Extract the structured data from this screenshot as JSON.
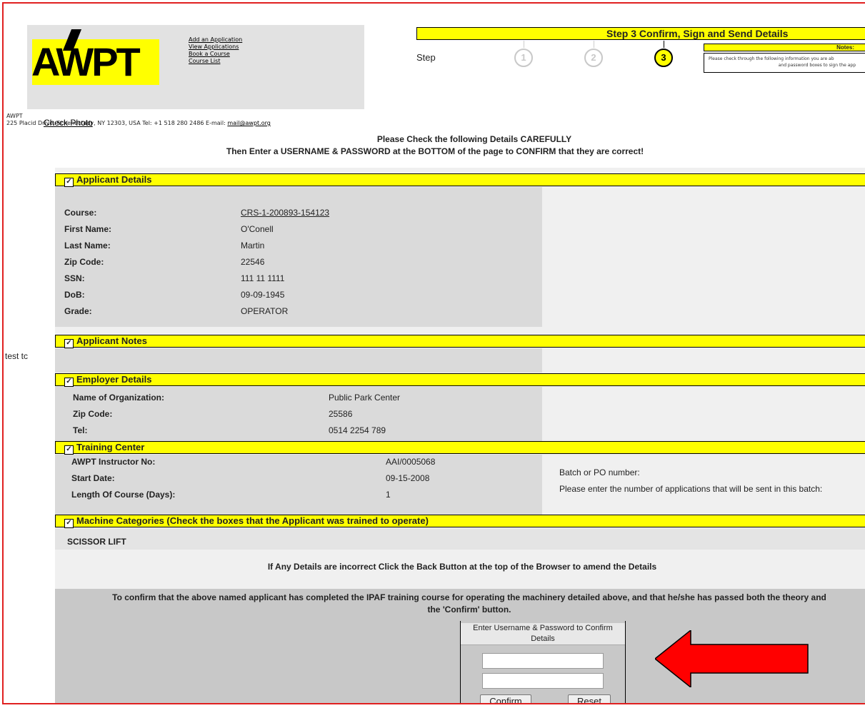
{
  "header": {
    "logo_text": "AWPT",
    "links": [
      "Add an Application",
      "View Applications",
      "Book a Course",
      "Course List"
    ],
    "org_name": "AWPT",
    "address": "225 Placid Drive, Schenectady, NY 12303, USA Tel: +1 518 280 2486 E-mail: ",
    "email": "mail@awpt.org",
    "check_photo": "Check Photo"
  },
  "steps": {
    "title": "Step 3 Confirm, Sign and Send Details",
    "label": "Step",
    "numbers": [
      "1",
      "2",
      "3"
    ],
    "current": 3,
    "notes_title": "Notes:",
    "notes_line1": "Please check through the following information you are ab",
    "notes_line2": "and password boxes to sign the app"
  },
  "warning": {
    "line1": "Please Check the following Details CAREFULLY",
    "line2": "Then Enter a USERNAME & PASSWORD at the BOTTOM of the page to CONFIRM that they are correct!"
  },
  "applicant": {
    "heading": "Applicant Details",
    "fields": [
      {
        "label": "Course:",
        "value": "CRS-1-200893-154123"
      },
      {
        "label": "First Name:",
        "value": "O'Conell"
      },
      {
        "label": "Last Name:",
        "value": "Martin"
      },
      {
        "label": "Zip Code:",
        "value": "22546"
      },
      {
        "label": "SSN:",
        "value": "111 11 1111"
      },
      {
        "label": "DoB:",
        "value": "09-09-1945"
      },
      {
        "label": "Grade:",
        "value": "OPERATOR"
      }
    ]
  },
  "notes": {
    "heading": "Applicant Notes",
    "text": "test tc"
  },
  "employer": {
    "heading": "Employer Details",
    "fields": [
      {
        "label": "Name of Organization:",
        "value": "Public Park Center"
      },
      {
        "label": "Zip Code:",
        "value": "25586"
      },
      {
        "label": "Tel:",
        "value": "0514 2254 789"
      }
    ]
  },
  "training": {
    "heading": "Training Center",
    "fields": [
      {
        "label": "AWPT Instructor No:",
        "value": "AAI/0005068"
      },
      {
        "label": "Start Date:",
        "value": "09-15-2008"
      },
      {
        "label": "Length Of Course (Days):",
        "value": "1"
      }
    ],
    "batch_label": "Batch or PO number:",
    "batch_hint": "Please enter the number of applications that will be sent in this batch:"
  },
  "machines": {
    "heading": "Machine Categories (Check the boxes that the Applicant was trained to operate)",
    "items": [
      "SCISSOR LIFT"
    ]
  },
  "instructions": "If Any Details are incorrect Click the Back Button at the top of the Browser to amend the Details",
  "confirm": {
    "text_line1": "To confirm that the above named applicant has completed the IPAF training course for operating the machinery detailed above, and that he/she has passed both the theory and",
    "text_line2": "the 'Confirm' button.",
    "login_title": "Enter Username & Password to Confirm Details",
    "confirm_label": "Confirm",
    "reset_label": "Reset"
  },
  "colors": {
    "highlight": "#ffff00",
    "arrow": "#ff0000",
    "frame": "#e02020"
  },
  "icons": {
    "checkbox": "checked-checkbox-icon",
    "pointer": "left-arrow-icon"
  }
}
